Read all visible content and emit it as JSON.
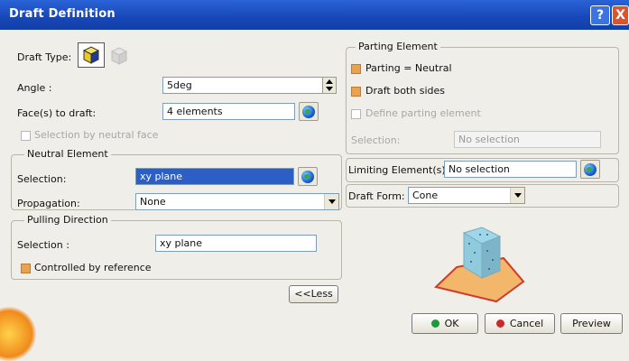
{
  "window": {
    "title": "Draft Definition",
    "help_label": "?",
    "close_label": "X"
  },
  "draft_type": {
    "label": "Draft Type:"
  },
  "angle": {
    "label": "Angle :",
    "value": "5deg"
  },
  "faces": {
    "label": "Face(s) to draft:",
    "value": "4 elements"
  },
  "selection_by_neutral": {
    "label": "Selection by neutral face"
  },
  "neutral_element": {
    "title": "Neutral Element",
    "selection_label": "Selection:",
    "selection_value": "xy plane",
    "propagation_label": "Propagation:",
    "propagation_value": "None"
  },
  "pulling_direction": {
    "title": "Pulling Direction",
    "selection_label": "Selection :",
    "selection_value": "xy plane",
    "controlled_label": "Controlled by reference"
  },
  "less_button": "<<Less",
  "parting_element": {
    "title": "Parting Element",
    "parting_neutral": "Parting = Neutral",
    "draft_both_sides": "Draft both sides",
    "define_parting": "Define parting element",
    "selection_label": "Selection:",
    "selection_value": "No selection"
  },
  "limiting": {
    "label": "Limiting Element(s):",
    "value": "No selection"
  },
  "draft_form": {
    "label": "Draft Form:",
    "value": "Cone"
  },
  "buttons": {
    "ok": "OK",
    "cancel": "Cancel",
    "preview": "Preview"
  },
  "colors": {
    "title_bar": "#1747b8",
    "accent_check": "#e9a24f",
    "selection": "#2c5fc6"
  }
}
